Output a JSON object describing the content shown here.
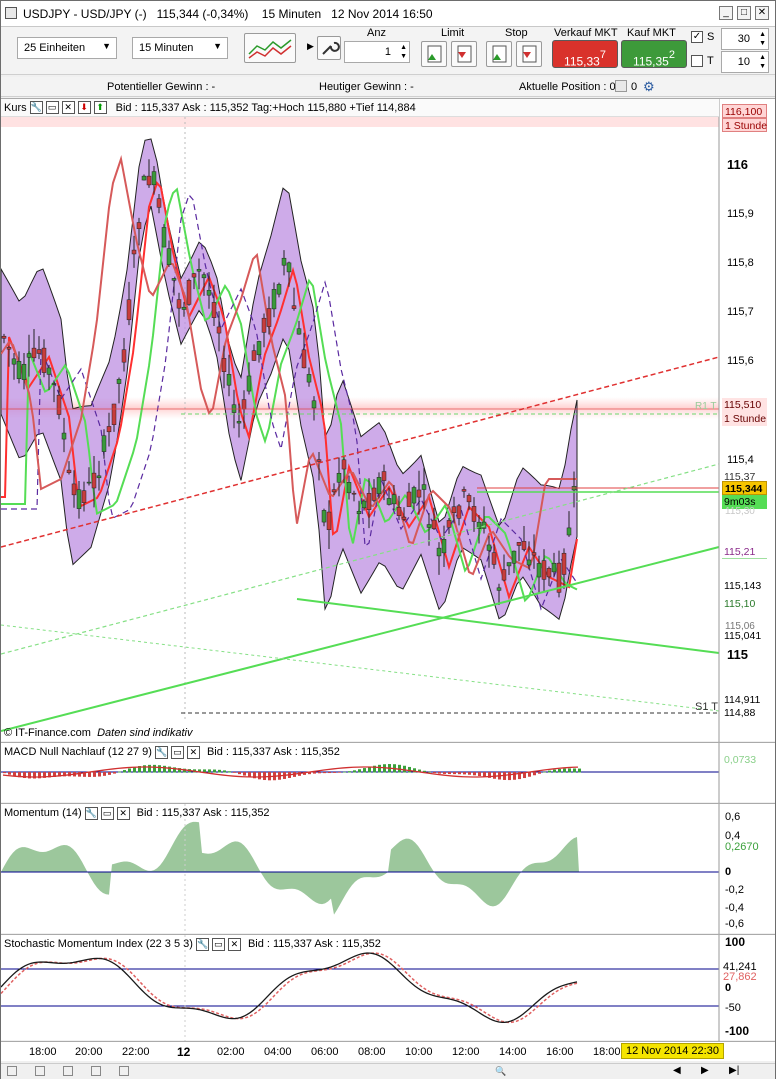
{
  "window": {
    "title": "USDJPY - USD/JPY (-)",
    "change_pct": "115,344 (-0,34%)",
    "timeframe": "15 Minuten",
    "datetime": "12 Nov 2014 16:50"
  },
  "toolbar": {
    "units_select": "25 Einheiten",
    "period_select": "15 Minuten",
    "anz_label": "Anz",
    "anz_value": "1",
    "limit_label": "Limit",
    "stop_label": "Stop",
    "sell_label": "Verkauf MKT",
    "sell_price_main": "115,33",
    "sell_price_sup": "7",
    "buy_label": "Kauf MKT",
    "buy_price_main": "115,35",
    "buy_price_sup": "2",
    "s_label": "S",
    "s_value": "30",
    "t_label": "T",
    "t_value": "10",
    "s_checked": true,
    "t_checked": false
  },
  "infobar": {
    "potential_gain": "Potentieller Gewinn : -",
    "today_gain": "Heutiger Gewinn : -",
    "position": "Aktuelle Position : 0"
  },
  "main_chart": {
    "label": "Kurs",
    "info": "Bid : 115,337 Ask : 115,352 Tag:+Hoch 115,880 +Tief 114,884",
    "watermark_source": "© IT-Finance.com",
    "watermark_note": "Daten sind indikativ",
    "axis_labels": [
      "116",
      "115,9",
      "115,8",
      "115,7",
      "115,6",
      "115,4",
      "115"
    ],
    "tag_top_value": "116,100",
    "tag_top_period": "1 Stunde",
    "tag_r_value": "115,510",
    "tag_r_period": "1 Stunde",
    "tag_r_faint": "R1 T",
    "tag_price": "115,344",
    "tag_last": "115,37",
    "tag_timer": "9m03s",
    "tag_1": "115,21",
    "tag_2": "115,143",
    "tag_3": "115,10",
    "tag_4": "115,041",
    "tag_4_faint": "115,06",
    "tag_s1": "S1 T",
    "tag_s1_val": "114,911",
    "tag_low": "114,88",
    "tag_faint_mid": "115,30"
  },
  "macd": {
    "label": "MACD Null Nachlauf (12 27 9)",
    "info": "Bid : 115,337 Ask : 115,352",
    "value": "0,0733"
  },
  "momentum": {
    "label": "Momentum (14)",
    "info": "Bid : 115,337 Ask : 115,352",
    "axis": [
      "0,6",
      "0,4",
      "0,2670",
      "0",
      "-0,2",
      "-0,4",
      "-0,6"
    ]
  },
  "stochastic": {
    "label": "Stochastic Momentum Index (22 3 5 3)",
    "info": "Bid : 115,337 Ask : 115,352",
    "axis": [
      "100",
      "41,241",
      "27,862",
      "0",
      "-50",
      "-100"
    ]
  },
  "time_axis": {
    "ticks": [
      "18:00",
      "20:00",
      "22:00",
      "12",
      "02:00",
      "04:00",
      "06:00",
      "08:00",
      "10:00",
      "12:00",
      "14:00",
      "16:00",
      "18:00"
    ],
    "current": "12 Nov 2014 22:30"
  },
  "colors": {
    "sell": "#d9322b",
    "buy": "#3d9a3a",
    "cloud": "#b987e0",
    "price_tag": "#f5c400",
    "green_line": "#55dd55",
    "red_line": "#e04040"
  }
}
